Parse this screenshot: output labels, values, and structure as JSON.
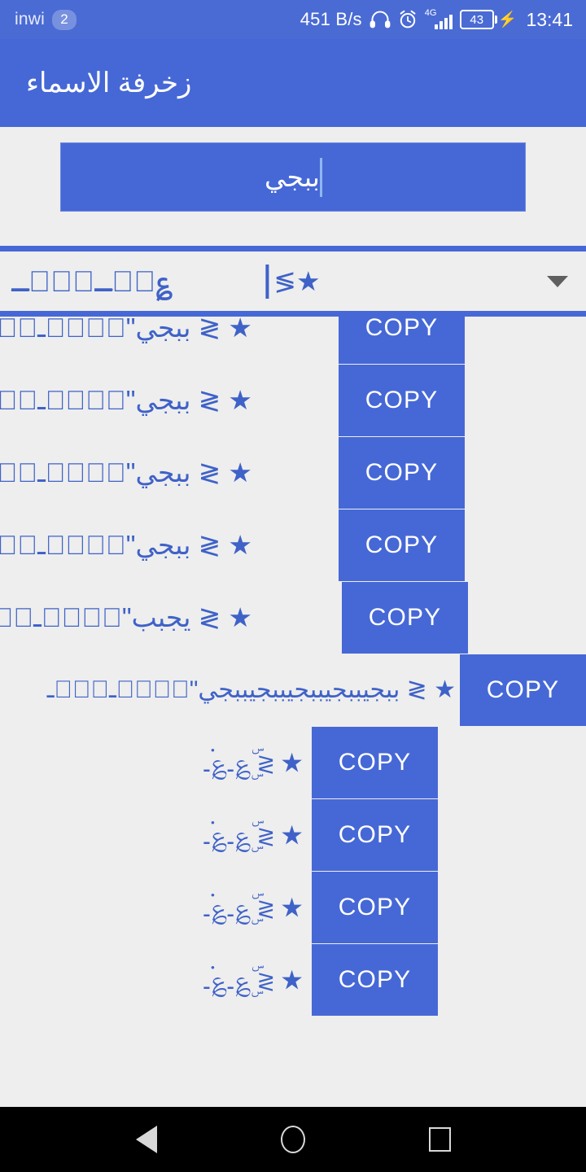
{
  "status_bar": {
    "carrier": "inwi",
    "sim_badge": "2",
    "network_speed": "451 B/s",
    "headphone_icon": "headphone-icon",
    "alarm_icon": "alarm-clock-icon",
    "network_type": "4G",
    "battery_level": "43",
    "charging_icon": "charging-bolt-icon",
    "clock": "13:41",
    "background_color": "#4a6bd4"
  },
  "app_bar": {
    "title": "زخرفة الاسماء",
    "background_color": "#4668d6"
  },
  "input": {
    "value": "ببجي",
    "placeholder": "ببجي",
    "background_color": "#4668d6",
    "text_color": "#ffffff"
  },
  "spinner": {
    "left_sample": "ـ؏ۣۗـ؏ۗ؏",
    "selected_sample": "≶★",
    "arrow_icon": "chevron-down-icon",
    "arrow_color": "#5f5f5f"
  },
  "list": {
    "copy_label": "COPY",
    "accent_color": "#4668d6",
    "text_color": "#3f62c8",
    "background_color": "#eeeeee",
    "rows": [
      {
        "text": "★ ≶ ببجي\"ۣۜ؏ٜـ؏ٜ۬ـ",
        "name": "ببجي",
        "style": "standard"
      },
      {
        "text": "★ ≶ ببجي\"ۣۜ؏ٜـ؏ٜ۬ـ",
        "name": "ببجي",
        "style": "standard"
      },
      {
        "text": "★ ≶ ببجي\"ۣۜ؏ٜـ؏ٜ۬ـ",
        "name": "ببجي",
        "style": "standard"
      },
      {
        "text": "★ ≶ ببجي\"ۣۜ؏ٜـ؏ٜ۬ـ",
        "name": "ببجي",
        "style": "standard"
      },
      {
        "text": "★ ≶ يجبب\"ۣۜ؏ٜـ؏ٜ۬ـ",
        "name": "يجبب",
        "style": "reversed"
      },
      {
        "text": "★ ≶ ببجيببجيببجيببجيببجي\"ۣۜ؏ٜـ؏ٜ۬ـ",
        "name": "ببجيببجيببجيببجيببجي",
        "style": "stretched"
      },
      {
        "text": "★ ≶ ۣۜ؏ٜـ؏ٜ۬ـ",
        "name": "",
        "style": "decor-only"
      },
      {
        "text": "★ ≶ ۣۜ؏ٜـ؏ٜ۬ـ",
        "name": "",
        "style": "decor-only"
      },
      {
        "text": "★ ≶ ۣۜ؏ٜـ؏ٜ۬ـ",
        "name": "",
        "style": "decor-only"
      },
      {
        "text": "★ ≶ ۣۜ؏ٜـ؏ٜ۬ـ",
        "name": "",
        "style": "decor-only"
      }
    ]
  },
  "nav_bar": {
    "back_icon": "back-triangle-icon",
    "home_icon": "home-circle-icon",
    "recents_icon": "recents-square-icon",
    "background_color": "#000000"
  }
}
